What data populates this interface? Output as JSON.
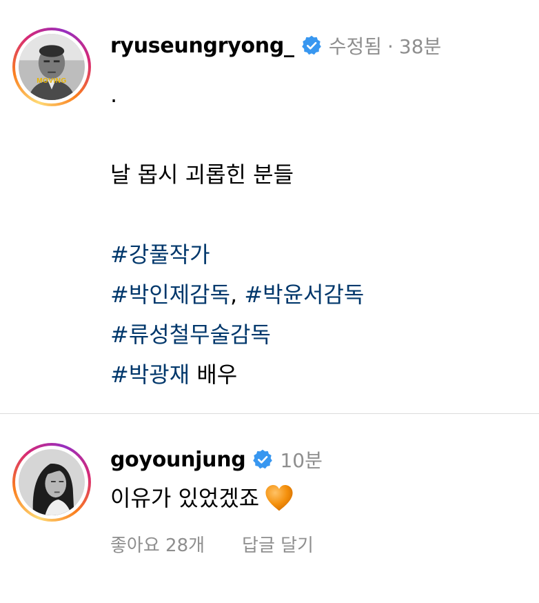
{
  "post": {
    "username": "ryuseungryong_",
    "edited_label": "수정됨",
    "separator": "·",
    "time": "38분",
    "avatar_badge_text": "MOVING",
    "lines": [
      {
        "parts": [
          {
            "text": ".",
            "hashtag": false
          }
        ]
      },
      {
        "parts": []
      },
      {
        "parts": [
          {
            "text": "날 몹시 괴롭힌 분들",
            "hashtag": false
          }
        ]
      },
      {
        "parts": []
      },
      {
        "parts": [
          {
            "text": "#강풀작가",
            "hashtag": true
          }
        ]
      },
      {
        "parts": [
          {
            "text": "#박인제감독",
            "hashtag": true
          },
          {
            "text": ", ",
            "hashtag": false
          },
          {
            "text": "#박윤서감독",
            "hashtag": true
          }
        ]
      },
      {
        "parts": [
          {
            "text": "#류성철무술감독",
            "hashtag": true
          }
        ]
      },
      {
        "parts": [
          {
            "text": "#박광재",
            "hashtag": true
          },
          {
            "text": " 배우",
            "hashtag": false
          }
        ]
      }
    ]
  },
  "comment": {
    "username": "goyounjung",
    "time": "10분",
    "text": "이유가 있었겠죠",
    "emoji_icon": "orange-heart-icon",
    "likes_label": "좋아요 28개",
    "reply_label": "답글 달기"
  },
  "colors": {
    "hashtag": "#00376b",
    "muted": "#8e8e8e",
    "verified": "#3897f0",
    "divider": "#dbdbdb",
    "heart": "#f4900c"
  }
}
